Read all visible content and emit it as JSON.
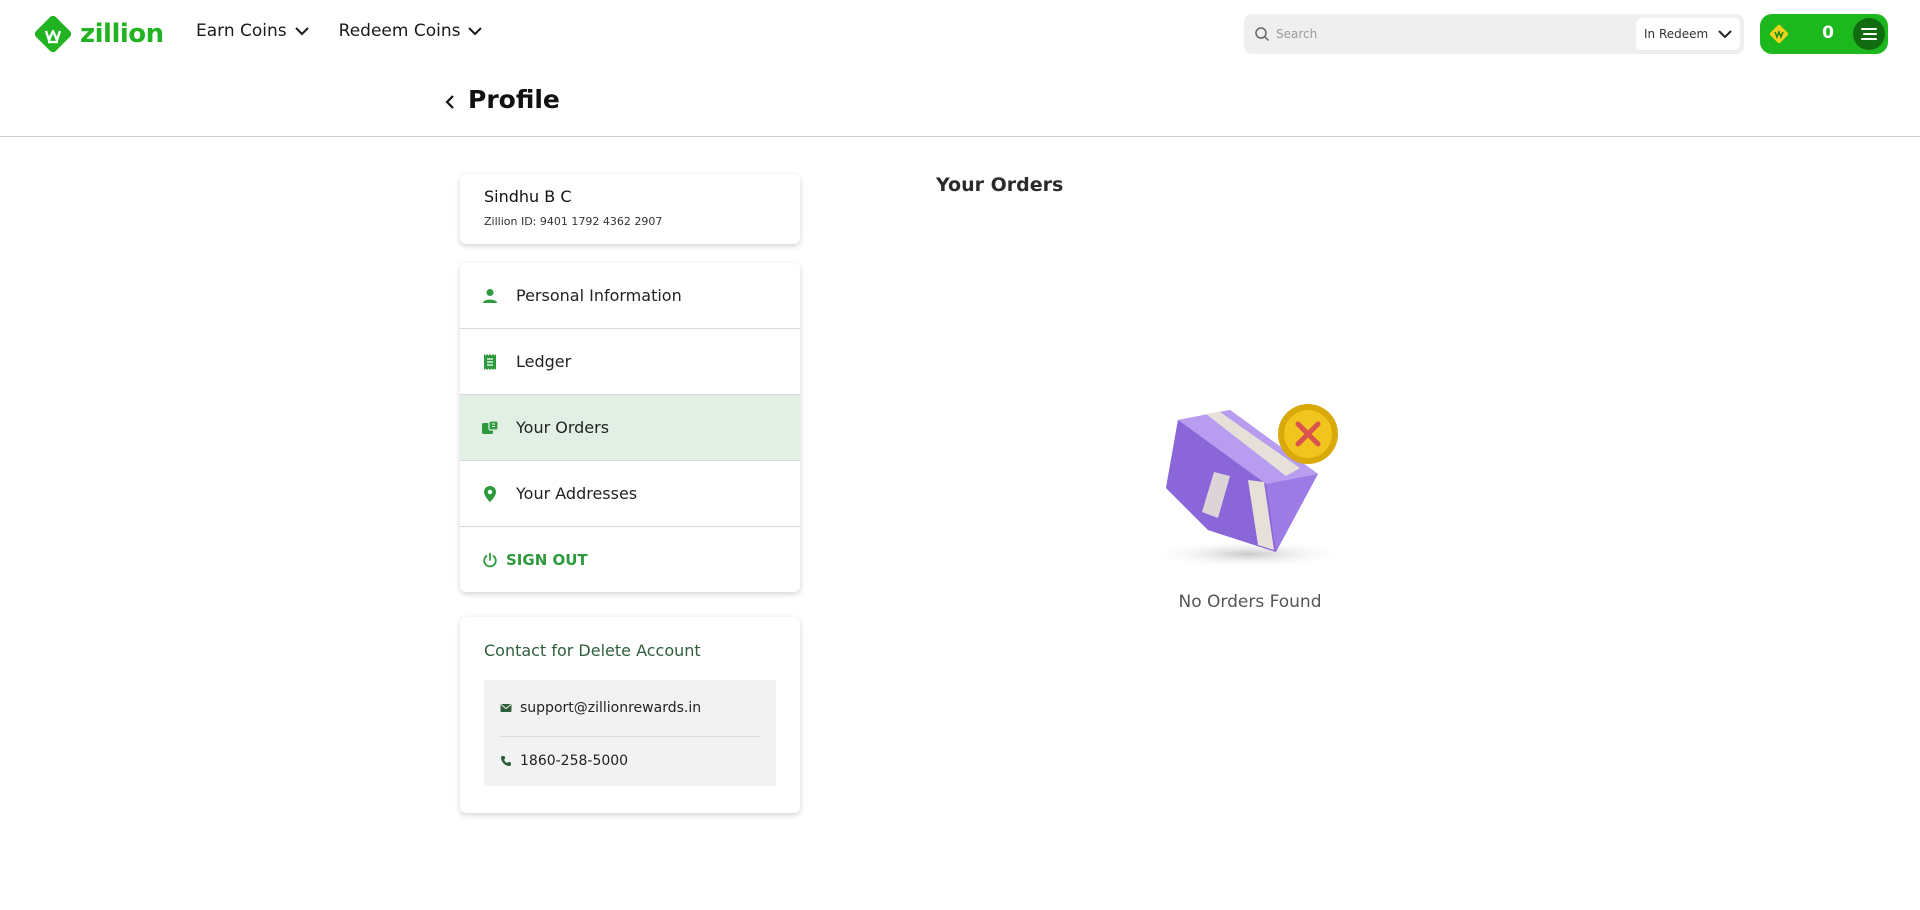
{
  "header": {
    "logo_text": "zillion",
    "nav": [
      {
        "label": "Earn Coins"
      },
      {
        "label": "Redeem Coins"
      }
    ],
    "search": {
      "placeholder": "Search",
      "scope_label": "In Redeem"
    },
    "wallet": {
      "count": "0"
    }
  },
  "page": {
    "title": "Profile"
  },
  "user": {
    "name": "Sindhu B C",
    "zillion_id": "Zillion ID: 9401 1792 4362 2907"
  },
  "menu": {
    "items": [
      {
        "label": "Personal Information",
        "icon": "person-icon"
      },
      {
        "label": "Ledger",
        "icon": "receipt-icon"
      },
      {
        "label": "Your Orders",
        "icon": "orders-icon",
        "active": true
      },
      {
        "label": "Your Addresses",
        "icon": "location-pin-icon"
      }
    ],
    "sign_out": "SIGN OUT"
  },
  "contact": {
    "title": "Contact for Delete Account",
    "email": "support@zillionrewards.in",
    "phone": "1860-258-5000"
  },
  "orders": {
    "title": "Your Orders",
    "empty_message": "No Orders Found"
  },
  "colors": {
    "brand_green": "#21b321",
    "accent_green": "#2e9a3e",
    "active_bg": "#e2efe4",
    "wallet_bg": "#1db81d"
  }
}
